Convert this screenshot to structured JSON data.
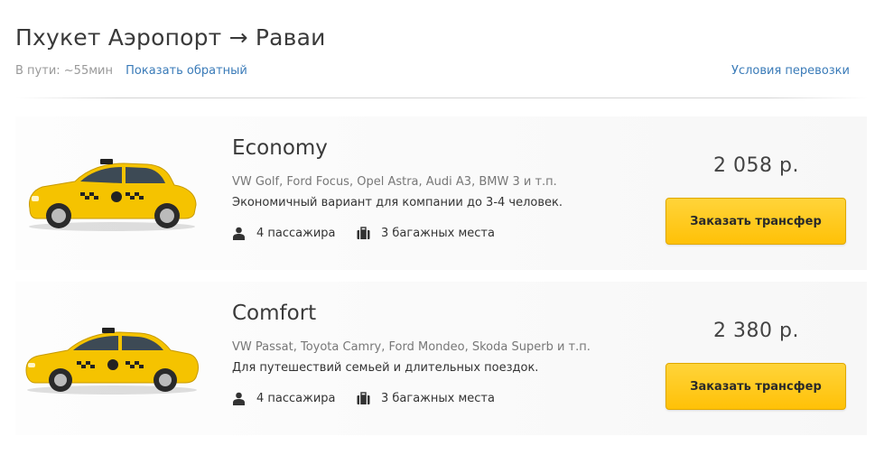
{
  "route": {
    "title": "Пхукет Аэропорт → Раваи",
    "duration": "В пути: ~55мин",
    "reverse_link": "Показать обратный",
    "terms_link": "Условия перевозки"
  },
  "classes": [
    {
      "name": "Economy",
      "models": "VW Golf, Ford Focus, Opel Astra, Audi A3, BMW 3 и т.п.",
      "description": "Экономичный вариант для компании до 3-4 человек.",
      "passengers": "4 пассажира",
      "luggage": "3 багажных места",
      "price": "2 058 р.",
      "button": "Заказать трансфер",
      "car_icon": "hatchback-taxi-icon"
    },
    {
      "name": "Comfort",
      "models": "VW Passat, Toyota Camry, Ford Mondeo, Skoda Superb и т.п.",
      "description": "Для путешествий семьей и длительных поездок.",
      "passengers": "4 пассажира",
      "luggage": "3 багажных места",
      "price": "2 380 р.",
      "button": "Заказать трансфер",
      "car_icon": "sedan-taxi-icon"
    }
  ],
  "colors": {
    "accent_button": "#ffc107",
    "link": "#3a7bb8",
    "taxi_yellow": "#f5c300"
  }
}
